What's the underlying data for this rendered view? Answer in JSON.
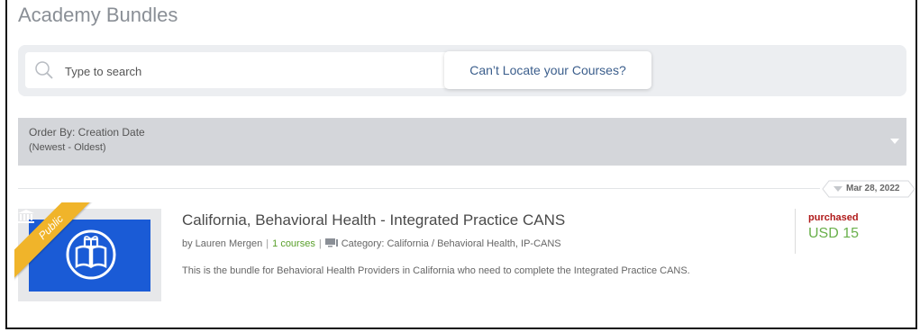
{
  "page": {
    "title": "Academy Bundles"
  },
  "search": {
    "placeholder": "Type to search",
    "value": "",
    "locate_button": "Can’t Locate your Courses?"
  },
  "order": {
    "label": "Order By: Creation Date",
    "sublabel": "(Newest - Oldest)"
  },
  "bundles": [
    {
      "date": "Mar 28, 2022",
      "ribbon": "Public",
      "title": "California, Behavioral Health - Integrated Practice CANS",
      "author": "by Lauren Mergen",
      "courses": "1 courses",
      "category": "Category: California / Behavioral Health, IP-CANS",
      "description": "This is the bundle for Behavioral Health Providers in California who need to complete the Integrated Practice CANS.",
      "status": "purchased",
      "price": "USD 15"
    }
  ],
  "colors": {
    "thumbnail": "#1a5bd6",
    "ribbon": "#f0b42a",
    "purchased": "#b01a1a",
    "price": "#6ab04c",
    "courses": "#5aa02c"
  },
  "icons": {
    "search": "search-icon",
    "order_dropdown": "chevron-down-icon",
    "thumbnail": "open-book-gift-icon",
    "ribbon": "bank-icon",
    "category": "monitor-icon"
  }
}
